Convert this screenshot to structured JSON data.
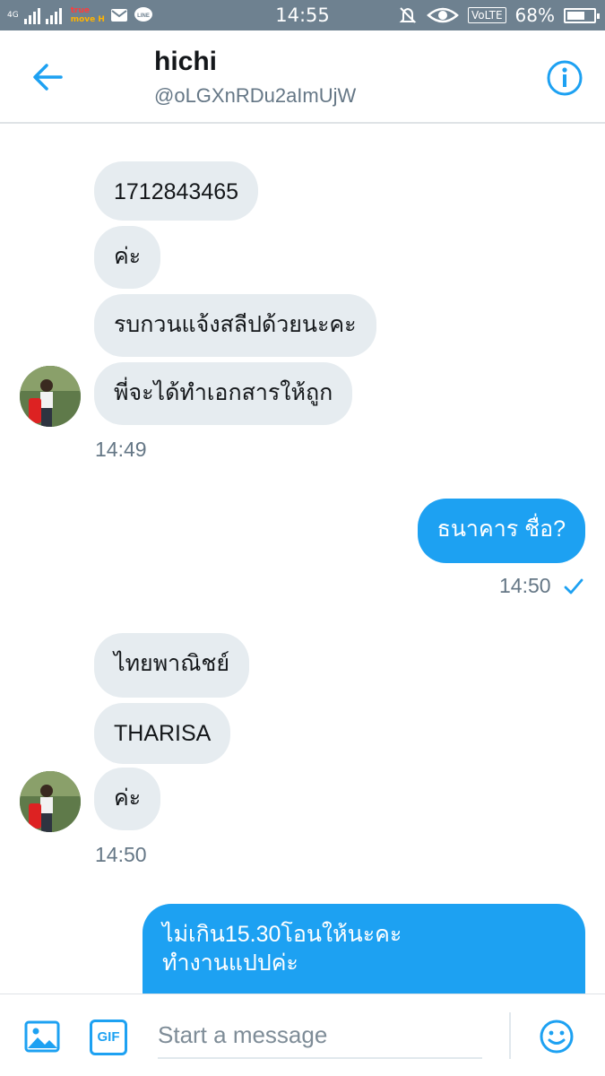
{
  "status_bar": {
    "time": "14:55",
    "network": "4G",
    "carrier_line1": "true",
    "carrier_line2": "move",
    "carrier_suffix": "H",
    "volte": "VoLTE",
    "battery": "68%",
    "battery_level": 0.68,
    "icons": [
      "signal-icon",
      "mail-icon",
      "line-app-icon",
      "mute-icon",
      "eye-icon",
      "battery-icon"
    ]
  },
  "header": {
    "name": "hichi",
    "handle": "@oLGXnRDu2aImUjW",
    "back_icon": "back-arrow-icon",
    "info_icon": "info-icon"
  },
  "messages": {
    "in_1": "1712843465",
    "in_2": "ค่ะ",
    "in_3": "รบกวนแจ้งสลีปด้วยนะคะ",
    "in_4": "พี่จะได้ทำเอกสารให้ถูก",
    "ts_1": "14:49",
    "out_1": "ธนาคาร ชื่อ?",
    "ts_2": "14:50",
    "in_5": "ไทยพาณิชย์",
    "in_6": "THARISA",
    "in_7": "ค่ะ",
    "ts_3": "14:50",
    "out_2": "ไม่เกิน15.30โอนให้นะคะ\nทำงานแปปค่ะ"
  },
  "composer": {
    "placeholder": "Start a message",
    "gif_label": "GIF",
    "image_icon": "image-icon",
    "emoji_icon": "emoji-icon"
  },
  "colors": {
    "accent": "#1da1f2",
    "incoming_bubble": "#e6ecf0",
    "status_bar": "#6e8190",
    "muted_text": "#657786"
  }
}
